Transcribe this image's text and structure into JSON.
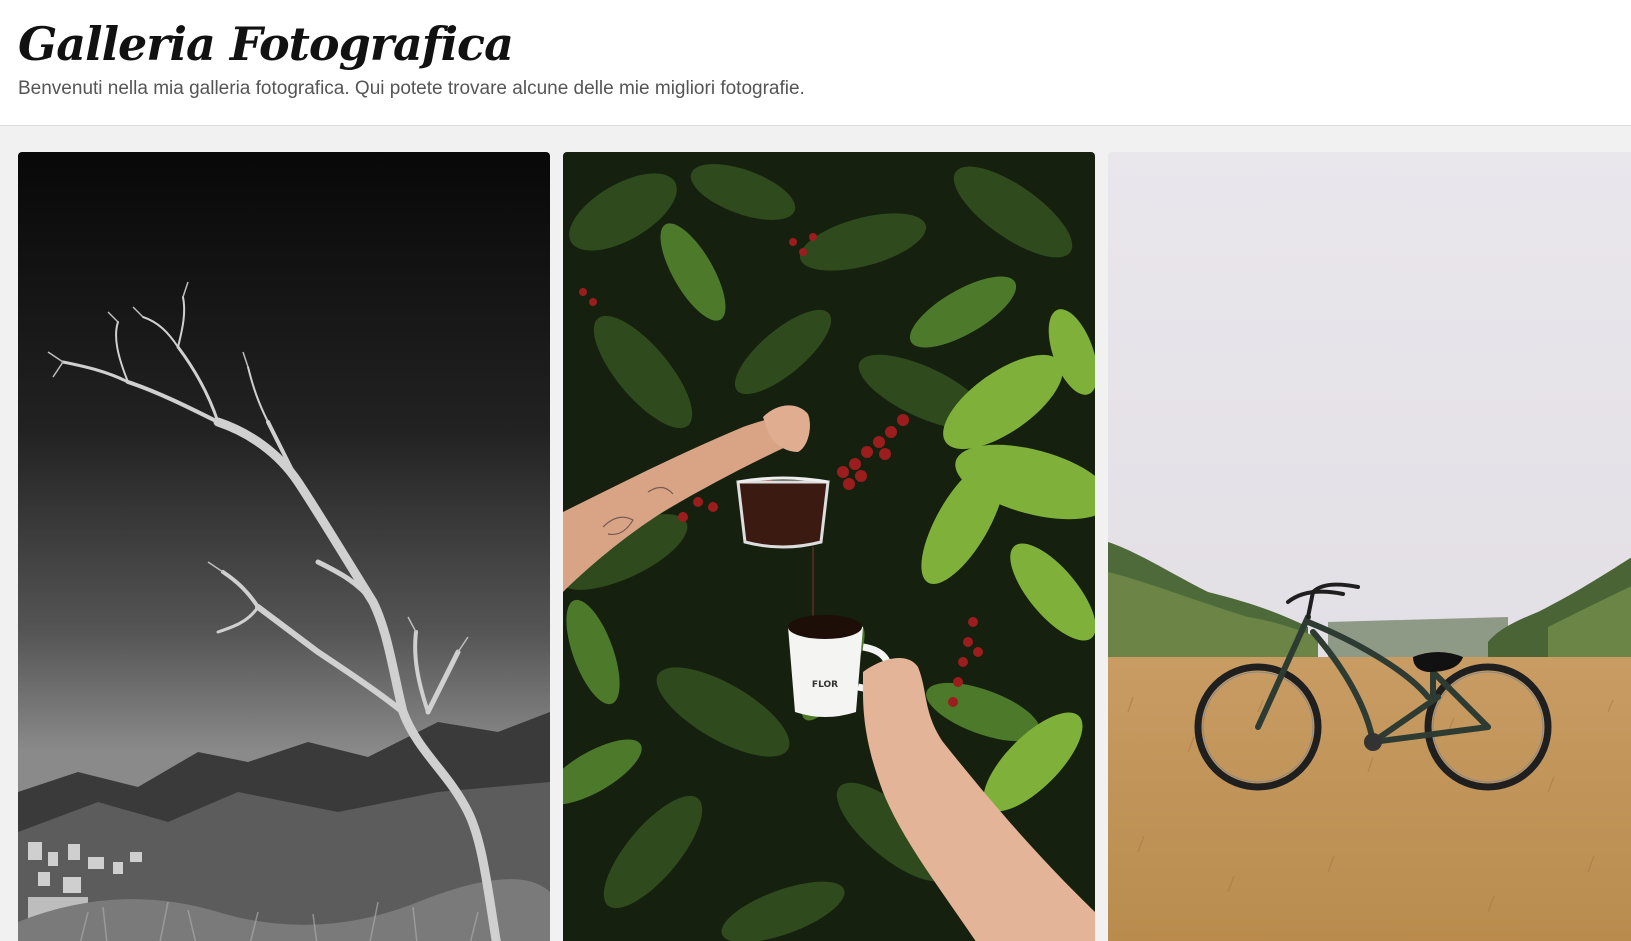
{
  "header": {
    "title": "Galleria Fotografica",
    "subtitle": "Benvenuti nella mia galleria fotografica. Qui potete trovare alcune delle mie migliori fotografie."
  },
  "gallery": {
    "photos": [
      {
        "subject": "black-and-white-tree-photo",
        "mug_text": ""
      },
      {
        "subject": "coffee-pour-photo",
        "mug_text": "FLOR"
      },
      {
        "subject": "bicycle-field-photo",
        "mug_text": ""
      }
    ]
  },
  "colors": {
    "header_bg": "#ffffff",
    "page_bg": "#f1f1f1",
    "title": "#111111",
    "subtitle": "#555555"
  }
}
